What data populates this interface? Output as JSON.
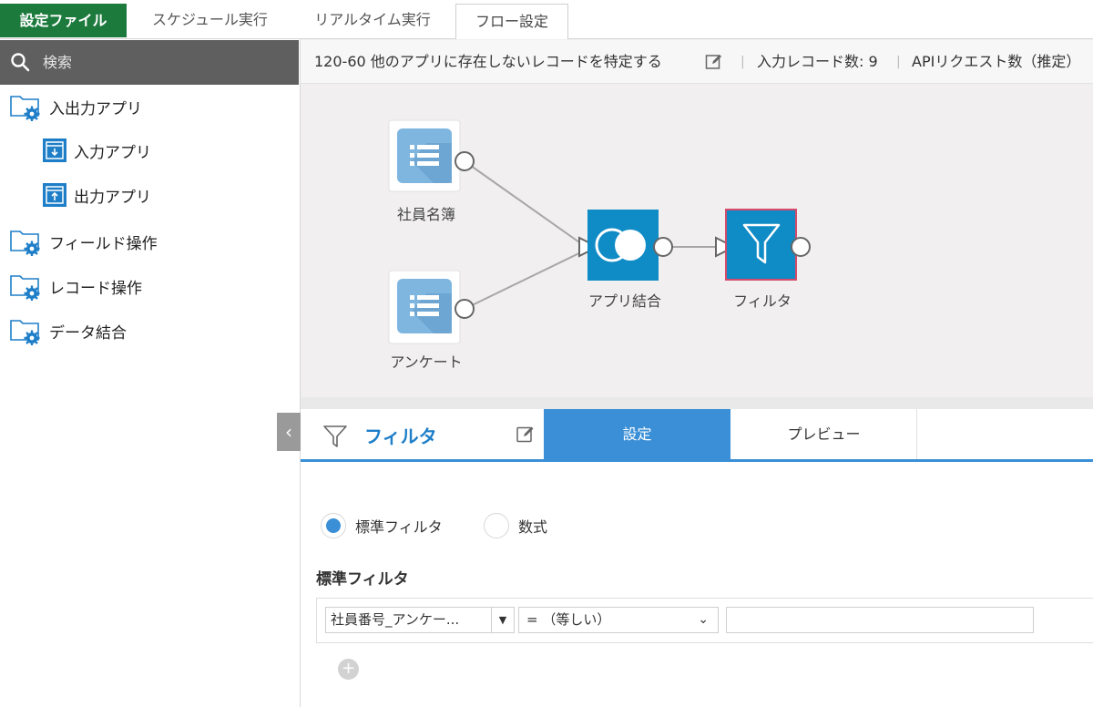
{
  "tabs": {
    "brand": "設定ファイル",
    "schedule": "スケジュール実行",
    "realtime": "リアルタイム実行",
    "flow": "フロー設定"
  },
  "sidebar": {
    "search_placeholder": "検索",
    "items": [
      {
        "label": "入出力アプリ",
        "icon": "folder-gear-icon"
      },
      {
        "label": "入力アプリ",
        "icon": "input-app-icon"
      },
      {
        "label": "出力アプリ",
        "icon": "output-app-icon"
      },
      {
        "label": "フィールド操作",
        "icon": "folder-gear-icon"
      },
      {
        "label": "レコード操作",
        "icon": "folder-gear-icon"
      },
      {
        "label": "データ結合",
        "icon": "folder-gear-icon"
      }
    ]
  },
  "canvas": {
    "title": "120-60 他のアプリに存在しないレコードを特定する",
    "separator": "|",
    "record_count": "入力レコード数: 9",
    "api_count": "APIリクエスト数（推定）",
    "nodes": {
      "employees": "社員名簿",
      "survey": "アンケート",
      "join": "アプリ結合",
      "filter": "フィルタ"
    }
  },
  "panel": {
    "collapse": "‹",
    "title": "フィルタ",
    "tab_settings": "設定",
    "tab_preview": "プレビュー",
    "radio_standard": "標準フィルタ",
    "radio_formula": "数式",
    "section_title": "標準フィルタ",
    "field_select": "社員番号_アンケー...",
    "field_arrow": "▼",
    "operator_select": "= （等しい）",
    "operator_arrow": "⌄",
    "value": "",
    "add": "+"
  },
  "colors": {
    "brand_green": "#1c7a3c",
    "accent_blue": "#3a8fd6",
    "node_blue": "#0f8bc6",
    "app_icon_blue": "#7fb6e0",
    "selected_border": "#d64a6a"
  }
}
